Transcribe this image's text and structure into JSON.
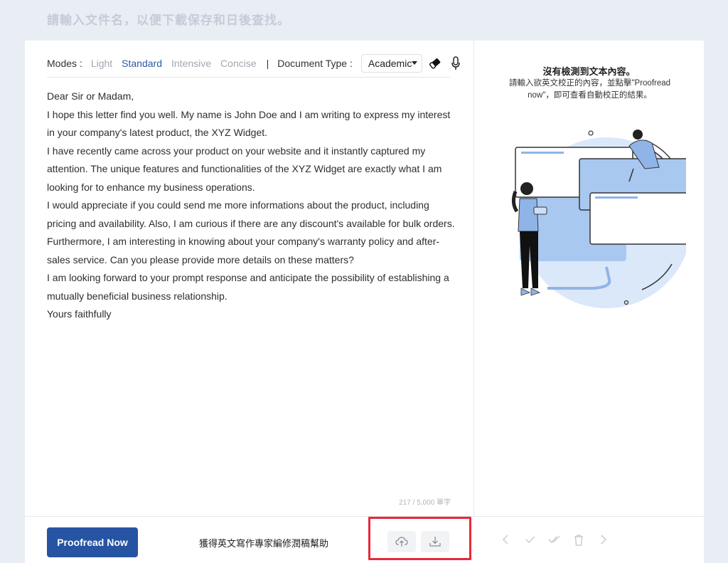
{
  "header": {
    "filename_placeholder": "請輸入文件名，以便下載保存和日後查找。"
  },
  "toolbar": {
    "modes_label": "Modes :",
    "modes": [
      "Light",
      "Standard",
      "Intensive",
      "Concise"
    ],
    "active_mode": "Standard",
    "separator": "|",
    "doctype_label": "Document Type :",
    "doctype_value": "Academic",
    "icons": [
      "eraser-icon",
      "microphone-icon"
    ]
  },
  "editor": {
    "lines": [
      "Dear Sir or Madam,",
      "I hope this letter find you well. My name is John Doe and I am writing to express my interest in your company's latest product, the XYZ Widget.",
      "I have recently came across your product on your website and it instantly captured my attention. The unique features and functionalities of the XYZ Widget are exactly what I am looking for to enhance my business operations.",
      "I would appreciate if you could send me more informations about the product, including pricing and availability. Also, I am curious if there are any discount's available for bulk orders.",
      "Furthermore, I am interesting in knowing about your company's warranty policy and after-sales service. Can you please provide more details on these matters?",
      "I am looking forward to your prompt response and anticipate the possibility of establishing a mutually beneficial business relationship.",
      "Yours faithfully"
    ],
    "word_count": "217 / 5,000 單字"
  },
  "bottom": {
    "proofread_label": "Proofread Now",
    "expert_label": "獲得英文寫作專家編修潤稿幫助",
    "icons": [
      "upload-cloud-icon",
      "download-icon",
      "chevron-left-icon",
      "check-icon",
      "check-all-icon",
      "trash-icon",
      "chevron-right-icon"
    ]
  },
  "result": {
    "title": "沒有檢測到文本內容。",
    "description": "請輸入欲英文校正的內容，並點擊\"Proofread now\"，即可查看自動校正的結果。"
  },
  "colors": {
    "accent": "#2753a3",
    "highlight": "#e8293a",
    "illustration_blue": "#a9c8f0"
  }
}
